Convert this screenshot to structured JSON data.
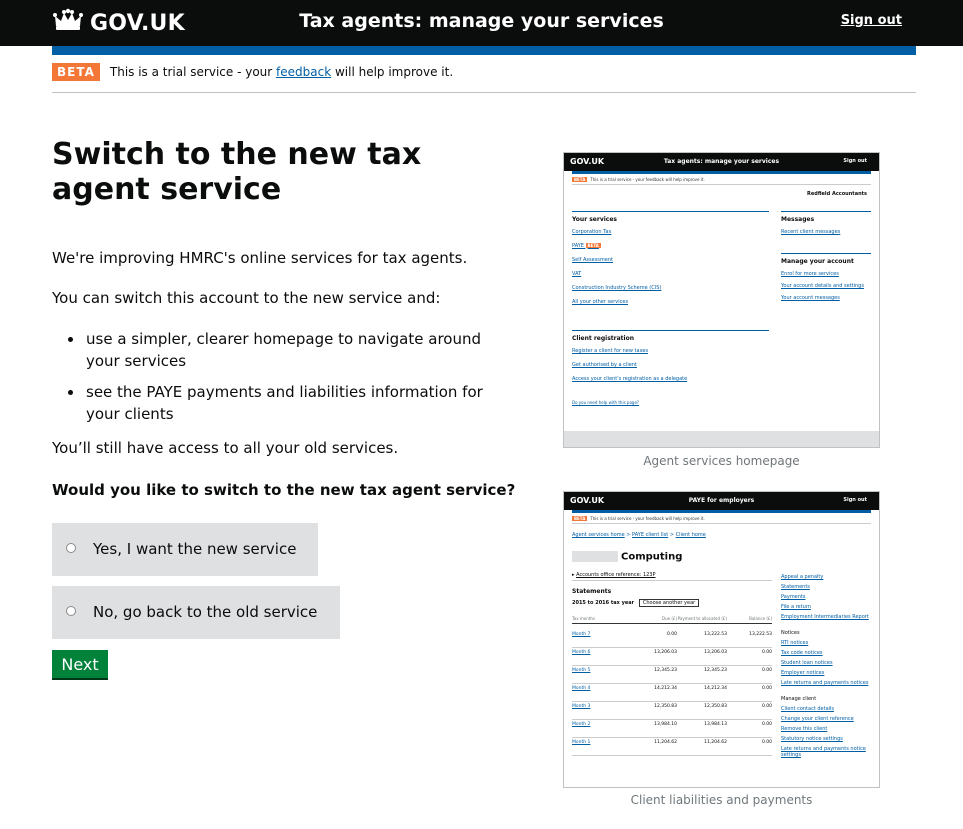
{
  "header": {
    "logo_text": "GOV.UK",
    "service_name": "Tax agents: manage your services",
    "signout": "Sign out"
  },
  "beta": {
    "tag": "BETA",
    "text_before": "This is a trial service - your ",
    "link": "feedback",
    "text_after": " will help improve it."
  },
  "main": {
    "title": "Switch to the new tax agent service",
    "intro": "We're improving HMRC's online services for tax agents.",
    "lead": "You can switch this account to the new service and:",
    "bullets": [
      "use a simpler, clearer homepage to navigate around your services",
      "see the PAYE payments and liabilities information for your clients"
    ],
    "outro": "You’ll still have access to all your old services.",
    "question": "Would you like to switch to the new tax agent service?",
    "options": [
      {
        "label": "Yes, I want the new service",
        "selected": false
      },
      {
        "label": "No, go back to the old service",
        "selected": false
      }
    ],
    "next_button": "Next"
  },
  "screenshots": [
    {
      "caption": "Agent services homepage",
      "service": "Tax agents: manage your services",
      "logo": "GOV.UK",
      "signout": "Sign out",
      "beta": "This is a trial service - your feedback will help improve it.",
      "account_name": "Redfield Accountants",
      "your_services_heading": "Your services",
      "services": [
        "Corporation Tax",
        "PAYE",
        "Self Assessment",
        "VAT",
        "Construction Industry Scheme (CIS)",
        "All your other services"
      ],
      "paye_badge": "BETA",
      "messages_heading": "Messages",
      "messages_link": "Recent client messages",
      "manage_heading": "Manage your account",
      "manage_links": [
        "Enrol for more services",
        "Your account details and settings",
        "Your account messages"
      ],
      "client_heading": "Client registration",
      "client_links": [
        "Register a client for new taxes",
        "Get authorised by a client",
        "Access your client's registration as a delegate"
      ],
      "help_link": "Do you need help with this page?"
    },
    {
      "caption": "Client liabilities and payments",
      "service": "PAYE for employers",
      "logo": "GOV.UK",
      "signout": "Sign out",
      "beta": "This is a trial service - your feedback will help improve it.",
      "breadcrumb": [
        "Agent services home",
        "PAYE client list",
        "Client home"
      ],
      "client_name": "Computing",
      "accounts_ref": "Accounts office reference: 123P",
      "statements_heading": "Statements",
      "tax_year_label": "2015 to 2016 tax year",
      "tax_year_select": "Choose another year",
      "columns": [
        "Tax months",
        "Due (£)",
        "Payment to allocated (£)",
        "Balance (£)"
      ],
      "rows": [
        [
          "Month 7",
          "0.00",
          "13,222.53",
          "13,222.53"
        ],
        [
          "Month 6",
          "13,206.03",
          "13,206.03",
          "0.00"
        ],
        [
          "Month 5",
          "12,345.23",
          "12,345.23",
          "0.00"
        ],
        [
          "Month 4",
          "14,212.34",
          "14,212.34",
          "0.00"
        ],
        [
          "Month 3",
          "12,350.83",
          "12,350.83",
          "0.00"
        ],
        [
          "Month 2",
          "13,984.10",
          "13,984.13",
          "0.00"
        ],
        [
          "Month 1",
          "11,204.62",
          "11,204.62",
          "0.00"
        ]
      ],
      "side_links": [
        "Appeal a penalty",
        "Statements",
        "Payments",
        "File a return",
        "Employment Intermediaries Report"
      ],
      "notices_heading": "Notices",
      "notices_links": [
        "RTI notices",
        "Tax code notices",
        "Student loan notices",
        "Employer notices",
        "Late returns and payments notices"
      ],
      "manage_heading": "Manage client",
      "manage_links": [
        "Client contact details",
        "Change your client reference",
        "Remove this client",
        "Statutory notice settings",
        "Late returns and payments notice settings"
      ]
    }
  ]
}
